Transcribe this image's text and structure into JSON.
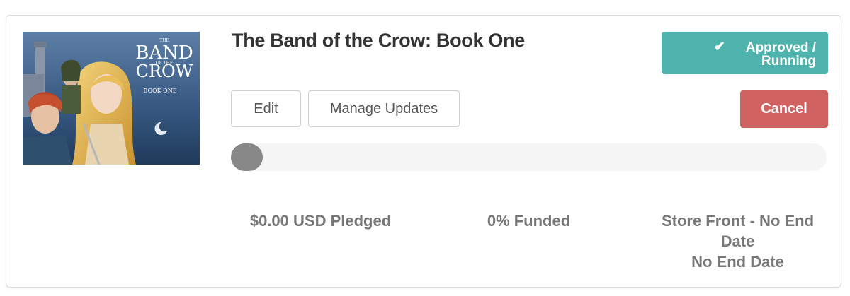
{
  "campaign": {
    "title": "The Band of the Crow: Book One",
    "cover": {
      "title_line1": "THE",
      "title_line2": "BAND",
      "title_line3": "OF THE",
      "title_line4": "CROW",
      "subtitle": "BOOK ONE"
    },
    "status_label": "Approved / Running",
    "status_icon": "check-icon",
    "edit_label": "Edit",
    "manage_updates_label": "Manage Updates",
    "cancel_label": "Cancel",
    "progress_percent": 0,
    "pledged": "$0.00 USD Pledged",
    "funded": "0% Funded",
    "end_type": "Store Front - No End Date",
    "end_date": "No End Date"
  },
  "colors": {
    "status": "#4fb3ad",
    "cancel": "#d06362",
    "progress_fill": "#888888",
    "progress_track": "#f5f5f5"
  }
}
